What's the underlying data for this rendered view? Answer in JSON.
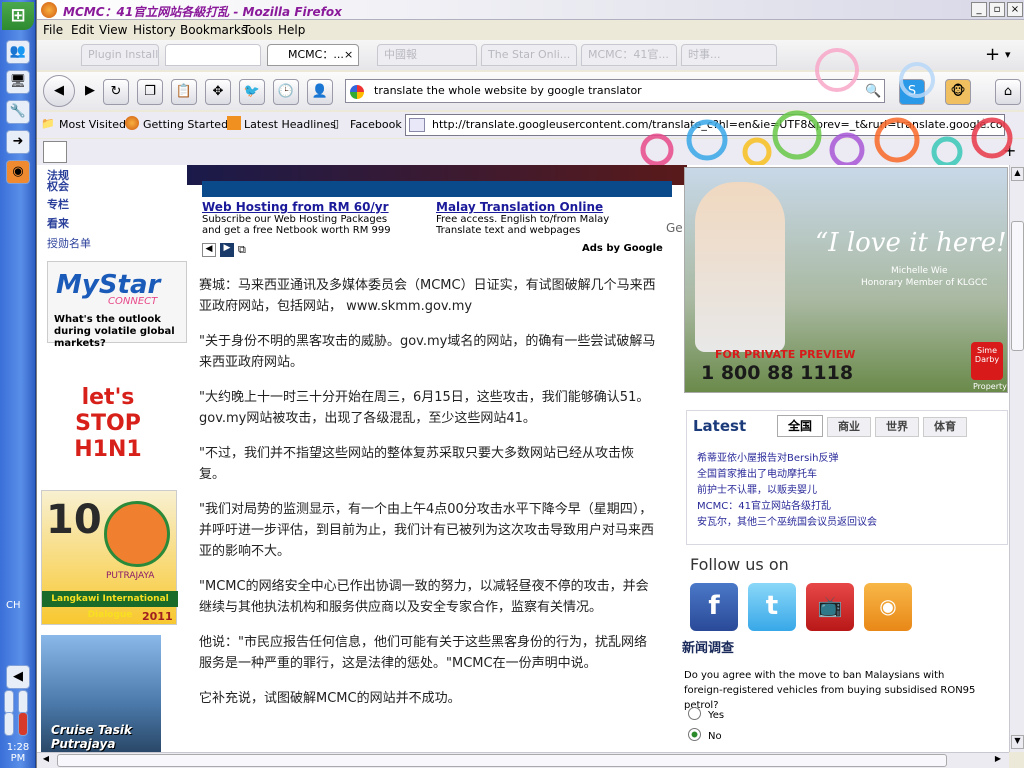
{
  "window": {
    "title": "MCMC：41官立网站各級打乱 - Mozilla Firefox"
  },
  "menu": [
    "File",
    "Edit",
    "View",
    "History",
    "Bookmarks",
    "Tools",
    "Help"
  ],
  "tabs": [
    {
      "label": "Plugin Installed",
      "active": false
    },
    {
      "label": "",
      "active": false
    },
    {
      "label": "MCMC：...",
      "active": true
    },
    {
      "label": "中國報",
      "active": false
    },
    {
      "label": "The Star Onli...",
      "active": false
    },
    {
      "label": "MCMC：41官...",
      "active": false
    },
    {
      "label": "时事...",
      "active": false
    }
  ],
  "nav": {
    "search_value": "translate the whole website by google translator"
  },
  "bookmarks": [
    "Most Visited",
    "Getting Started",
    "Latest Headlines",
    "Facebook"
  ],
  "url": "http://translate.googleusercontent.com/translate_c?hl=en&ie=UTF8&prev=_t&rurl=translate.google.com.my&",
  "left_nav": [
    "法规",
    "权会",
    "专栏",
    "看来",
    "授勋名单"
  ],
  "left_ads": {
    "mystar_logo": "MyStar",
    "mystar_sub": "CONNECT",
    "mystar_caption": "What's the outlook during volatile global markets?",
    "stop_h1n1": "let's STOP H1N1",
    "langkawi": "Langkawi International Dialogue",
    "langkawi_year": "2011",
    "langkawi_num": "10",
    "putrajaya": "PUTRAJAYA",
    "cruise": "Cruise Tasik Putrajaya"
  },
  "ads": [
    {
      "title": "Web Hosting from RM 60/yr",
      "line1": "Subscribe our Web Hosting Packages",
      "line2": "and get a free Netbook worth RM 999"
    },
    {
      "title": "Malay Translation Online",
      "line1": "Free access. English to/from Malay",
      "line2": "Translate text and webpages"
    }
  ],
  "ads_by": "Ads by Google",
  "ad_cut": "Ge",
  "article": [
    "赛城：马来西亚通讯及多媒体委员会（MCMC）日证实，有试图破解几个马来西亚政府网站，包括网站， www.skmm.gov.my",
    "\"关于身份不明的黑客攻击的威胁。gov.my域名的网站，的确有一些尝试破解马来西亚政府网站。",
    "\"大约晚上十一时三十分开始在周三，6月15日，这些攻击，我们能够确认51。gov.my网站被攻击，出现了各级混乱，至少这些网站41。",
    "\"不过，我们并不指望这些网站的整体复苏采取只要大多数网站已经从攻击恢复。",
    "\"我们对局势的监测显示，有一个由上午4点00分攻击水平下降今早（星期四），并呼吁进一步评估，到目前为止，我们计有已被列为这次攻击导致用户对马来西亚的影响不大。",
    "\"MCMC的网络安全中心已作出协调一致的努力，以减轻昼夜不停的攻击，并会继续与其他执法机构和服务供应商以及安全专家合作，监察有关情况。",
    "他说：\"市民应报告任何信息，他们可能有关于这些黑客身份的行为，扰乱网络服务是一种严重的罪行，这是法律的惩处。\"MCMC在一份声明中说。",
    "它补充说，试图破解MCMC的网站并不成功。"
  ],
  "right_ad": {
    "quote": "“I love it here!”",
    "name": "Michelle Wie",
    "role": "Honorary Member of KLGCC",
    "preview": "FOR PRIVATE PREVIEW",
    "phone": "1 800 88 1118",
    "brand": "Sime Darby",
    "brand_sub": "Property"
  },
  "latest": {
    "title": "Latest",
    "tabs": [
      "全国",
      "商业",
      "世界",
      "体育"
    ],
    "items": [
      "希蒂亚依小屋报告对Bersih反弹",
      "全国首家推出了电动摩托车",
      "前护士不认罪，以贩卖婴儿",
      "MCMC：41官立网站各级打乱",
      "安瓦尔，其他三个巫统国会议员返回议会"
    ]
  },
  "follow": {
    "title": "Follow us on"
  },
  "survey": {
    "title": "新闻调查",
    "question": "Do you agree with the move to ban Malaysians with foreign-registered vehicles from buying subsidised RON95 petrol?",
    "options": [
      "Yes",
      "No"
    ],
    "selected": "No"
  },
  "taskbar": {
    "lang": "CH",
    "clock": "1:28 PM"
  }
}
